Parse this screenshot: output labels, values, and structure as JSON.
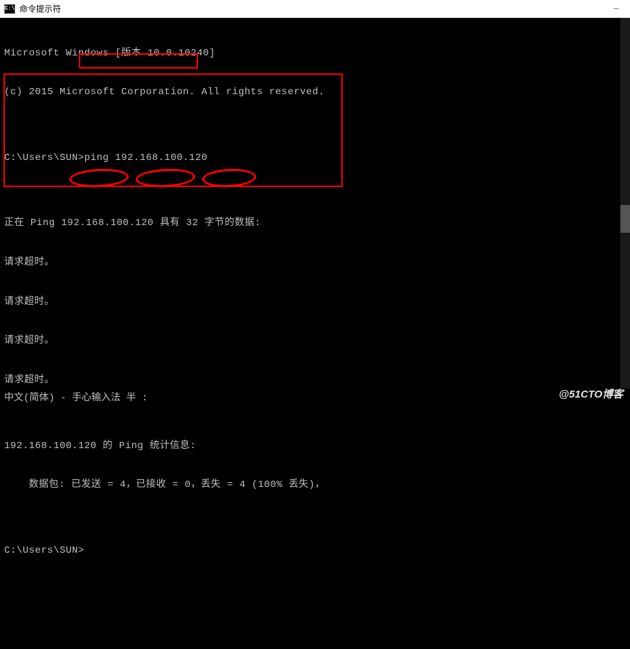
{
  "titlebar": {
    "icon_text": "C:\\",
    "title": "命令提示符"
  },
  "terminal": {
    "line1": "Microsoft Windows [版本 10.0.10240]",
    "line2": "(c) 2015 Microsoft Corporation. All rights reserved.",
    "blank1": "",
    "prompt1_path": "C:\\Users\\SUN>",
    "prompt1_cmd": "ping 192.168.100.120",
    "blank2": "",
    "ping_header": "正在 Ping 192.168.100.120 具有 32 字节的数据:",
    "timeout1": "请求超时。",
    "timeout2": "请求超时。",
    "timeout3": "请求超时。",
    "timeout4": "请求超时。",
    "blank3": "",
    "stats_header": "192.168.100.120 的 Ping 统计信息:",
    "stats_line": "    数据包: 已发送 = 4，已接收 = 0，丢失 = 4 (100% 丢失)，",
    "blank4": "",
    "prompt2": "C:\\Users\\SUN>"
  },
  "ime": {
    "text": "中文(简体) - 手心输入法 半 :"
  },
  "watermark": {
    "text": "@51CTO博客"
  }
}
